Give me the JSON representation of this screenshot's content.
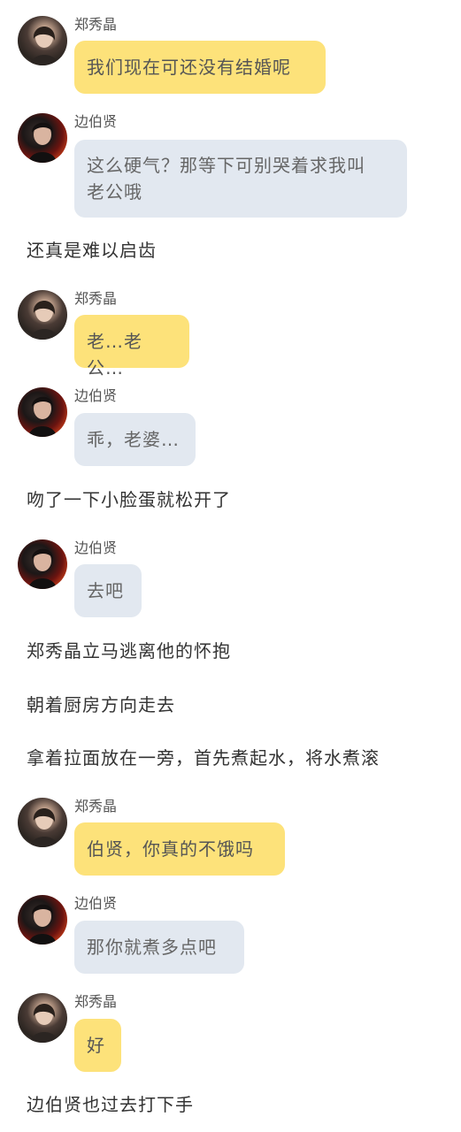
{
  "characters": {
    "female": {
      "name": "郑秀晶",
      "avatar_icon": "woman-portrait-avatar",
      "bubble_color": "#fde27a"
    },
    "male": {
      "name": "边伯贤",
      "avatar_icon": "man-portrait-avatar",
      "bubble_color": "#e2e8f0"
    }
  },
  "messages": [
    {
      "type": "chat",
      "speaker": "郑秀晶",
      "text": "我们现在可还没有结婚呢"
    },
    {
      "type": "chat",
      "speaker": "边伯贤",
      "text_line1": "这么硬气？那等下可别哭着求我叫",
      "text_line2": "老公哦"
    },
    {
      "type": "narration",
      "text": "还真是难以启齿"
    },
    {
      "type": "chat",
      "speaker": "郑秀晶",
      "text": "老…老公…"
    },
    {
      "type": "chat",
      "speaker": "边伯贤",
      "text": "乖，老婆…"
    },
    {
      "type": "narration",
      "text": "吻了一下小脸蛋就松开了"
    },
    {
      "type": "chat",
      "speaker": "边伯贤",
      "text": "去吧"
    },
    {
      "type": "narration",
      "text": "郑秀晶立马逃离他的怀抱"
    },
    {
      "type": "narration",
      "text": "朝着厨房方向走去"
    },
    {
      "type": "narration",
      "text": "拿着拉面放在一旁，首先煮起水，将水煮滚"
    },
    {
      "type": "chat",
      "speaker": "郑秀晶",
      "text": "伯贤，你真的不饿吗"
    },
    {
      "type": "chat",
      "speaker": "边伯贤",
      "text": "那你就煮多点吧"
    },
    {
      "type": "chat",
      "speaker": "郑秀晶",
      "text": "好"
    },
    {
      "type": "narration",
      "text": "边伯贤也过去打下手"
    }
  ]
}
